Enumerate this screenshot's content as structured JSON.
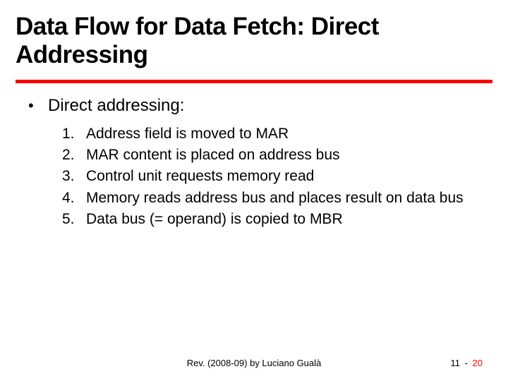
{
  "title": "Data Flow for Data Fetch: Direct Addressing",
  "bullet": {
    "dot": "•",
    "text": "Direct addressing:"
  },
  "steps": [
    {
      "num": "1.",
      "text": "Address field is moved to MAR"
    },
    {
      "num": "2.",
      "text": "MAR content is placed on address bus"
    },
    {
      "num": "3.",
      "text": "Control unit requests memory read"
    },
    {
      "num": "4.",
      "text": "Memory reads address bus and places result on data bus"
    },
    {
      "num": "5.",
      "text": "Data bus (= operand) is copied to MBR"
    }
  ],
  "footer": {
    "credit": "Rev. (2008-09) by Luciano Gualà",
    "chapter": "11",
    "sep": "-",
    "page": "20"
  }
}
